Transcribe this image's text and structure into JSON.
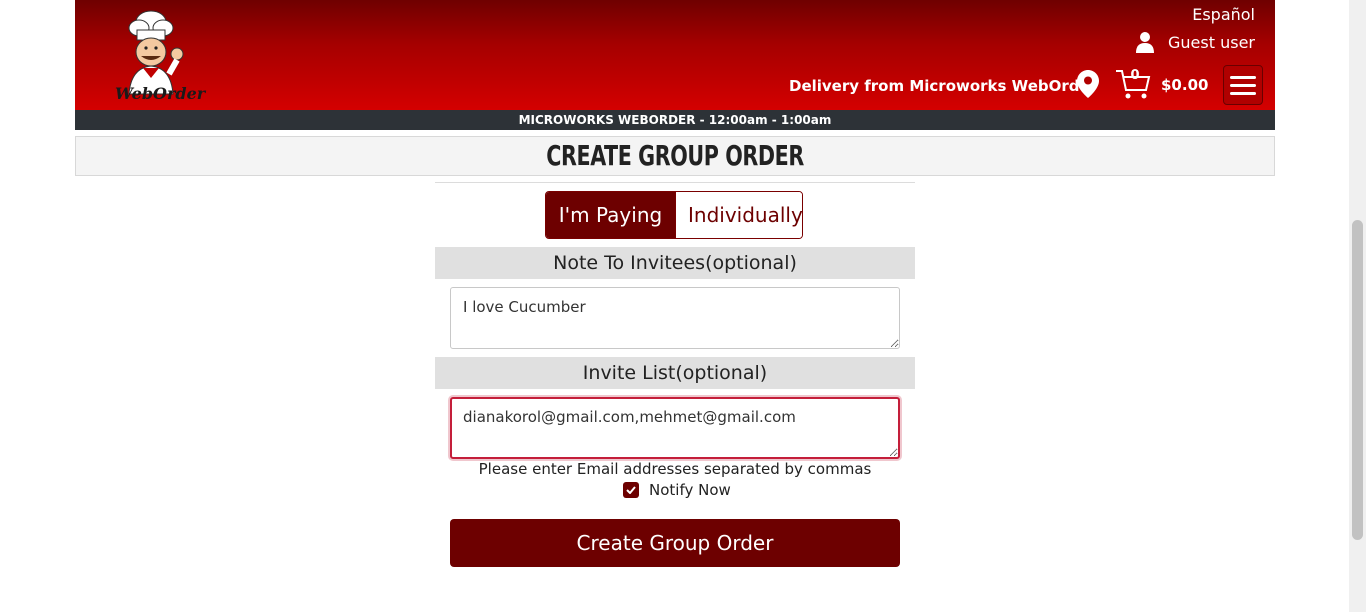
{
  "header": {
    "language_link": "Español",
    "user_label": "Guest user",
    "delivery_text": "Delivery from Microworks WebOrder",
    "cart_count": "0",
    "cart_total": "$0.00",
    "brand_accent": "#c00000",
    "logo_text": "WebOrder"
  },
  "hours_bar": "MICROWORKS WEBORDER - 12:00am - 1:00am",
  "page_title": "CREATE GROUP ORDER",
  "payment_toggle": {
    "option_paying": "I'm Paying",
    "option_individually": "Individually",
    "selected": "I'm Paying"
  },
  "note_section": {
    "label": "Note To Invitees(optional)",
    "value": "I love Cucumber"
  },
  "invite_section": {
    "label": "Invite List(optional)",
    "value": "dianakorol@gmail.com,mehmet@gmail.com",
    "hint": "Please enter Email addresses separated by commas"
  },
  "notify": {
    "label": "Notify Now",
    "checked": true
  },
  "submit_label": "Create Group Order",
  "colors": {
    "primary_dark_red": "#6d0000",
    "hours_bar_bg": "#2d3237",
    "focus_ring": "#c41e3a"
  }
}
